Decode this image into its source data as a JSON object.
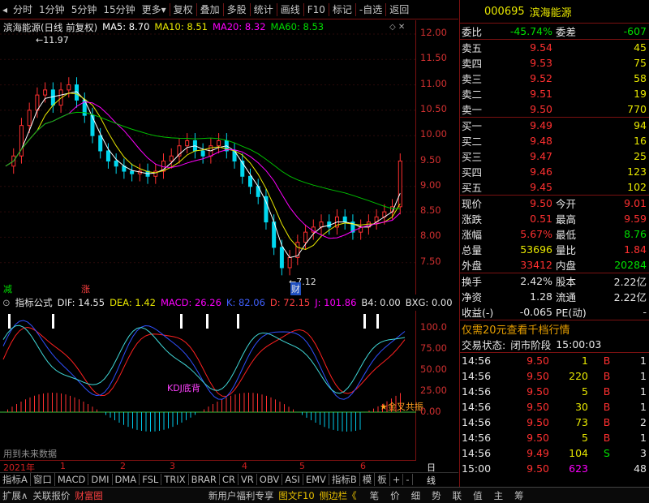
{
  "toolbar": {
    "periods": [
      "分时",
      "1分钟",
      "5分钟",
      "15分钟",
      "更多"
    ],
    "actions": [
      "复权",
      "叠加",
      "多股",
      "统计",
      "画线",
      "F10",
      "标记",
      "-自选",
      "返回"
    ]
  },
  "kchart": {
    "title": "滨海能源(日线 前复权)",
    "ma": [
      {
        "label": "MA5: 8.70",
        "color": "#ffffff"
      },
      {
        "label": "MA10: 8.51",
        "color": "#e8e800"
      },
      {
        "label": "MA20: 8.32",
        "color": "#ff00ff"
      },
      {
        "label": "MA60: 8.53",
        "color": "#00dd00"
      }
    ],
    "yticks": [
      "12.00",
      "11.50",
      "11.00",
      "10.50",
      "10.00",
      "9.50",
      "9.00",
      "8.50",
      "8.00",
      "7.50"
    ],
    "high_label": "11.97",
    "low_label": "7.12",
    "markers": {
      "minus": "减",
      "plus": "涨",
      "cai": "财"
    }
  },
  "indicator": {
    "name": "指标公式",
    "items": [
      {
        "label": "DIF: 14.55",
        "color": "#e6e6e6"
      },
      {
        "label": "DEA: 1.42",
        "color": "#e8e800"
      },
      {
        "label": "MACD: 26.26",
        "color": "#ff00ff"
      },
      {
        "label": "K: 82.06",
        "color": "#4060ff"
      },
      {
        "label": "D: 72.15",
        "color": "#ff4040"
      },
      {
        "label": "J: 101.86",
        "color": "#ff00ff"
      },
      {
        "label": "B4: 0.00",
        "color": "#e6e6e6"
      },
      {
        "label": "BXG: 0.00",
        "color": "#e6e6e6"
      }
    ],
    "yticks": [
      "100.0",
      "75.00",
      "50.00",
      "25.00",
      "0.00"
    ],
    "notes": {
      "kdj": "KDJ底背",
      "gold": "金叉共振",
      "future": "用到未来数据"
    }
  },
  "dates": {
    "year": "2021年",
    "months": [
      "1",
      "2",
      "3",
      "4",
      "5",
      "6"
    ],
    "right": "日线"
  },
  "tabs": [
    "指标A",
    "窗口",
    "MACD",
    "DMI",
    "DMA",
    "FSL",
    "TRIX",
    "BRAR",
    "CR",
    "VR",
    "OBV",
    "ASI",
    "EMV",
    "指标B",
    "模",
    "板",
    "+",
    "-"
  ],
  "statusbar": {
    "left": [
      "扩展∧",
      "关联报价",
      "财富圈"
    ],
    "middle": [
      "新用户福利专享",
      "图文F10",
      "侧边栏《"
    ],
    "right": [
      "笔",
      "价",
      "细",
      "势",
      "联",
      "值",
      "主",
      "筹"
    ]
  },
  "quote": {
    "code": "000695",
    "name": "滨海能源",
    "weibi_label": "委比",
    "weibi": "-45.74%",
    "weicha_label": "委差",
    "weicha": "-607",
    "asks": [
      {
        "label": "卖五",
        "price": "9.54",
        "vol": "45"
      },
      {
        "label": "卖四",
        "price": "9.53",
        "vol": "75"
      },
      {
        "label": "卖三",
        "price": "9.52",
        "vol": "58"
      },
      {
        "label": "卖二",
        "price": "9.51",
        "vol": "19"
      },
      {
        "label": "卖一",
        "price": "9.50",
        "vol": "770"
      }
    ],
    "bids": [
      {
        "label": "买一",
        "price": "9.49",
        "vol": "94"
      },
      {
        "label": "买二",
        "price": "9.48",
        "vol": "16"
      },
      {
        "label": "买三",
        "price": "9.47",
        "vol": "25"
      },
      {
        "label": "买四",
        "price": "9.46",
        "vol": "123"
      },
      {
        "label": "买五",
        "price": "9.45",
        "vol": "102"
      }
    ],
    "stats": [
      {
        "l1": "现价",
        "v1": "9.50",
        "c1": "red",
        "l2": "今开",
        "v2": "9.01",
        "c2": "red"
      },
      {
        "l1": "涨跌",
        "v1": "0.51",
        "c1": "red",
        "l2": "最高",
        "v2": "9.59",
        "c2": "red"
      },
      {
        "l1": "涨幅",
        "v1": "5.67%",
        "c1": "red",
        "l2": "最低",
        "v2": "8.76",
        "c2": "green"
      },
      {
        "l1": "总量",
        "v1": "53696",
        "c1": "yel",
        "l2": "量比",
        "v2": "1.84",
        "c2": "red"
      },
      {
        "l1": "外盘",
        "v1": "33412",
        "c1": "red",
        "l2": "内盘",
        "v2": "20284",
        "c2": "green"
      }
    ],
    "stats2": [
      {
        "l1": "换手",
        "v1": "2.42%",
        "l2": "股本",
        "v2": "2.22亿"
      },
      {
        "l1": "净资",
        "v1": "1.28",
        "l2": "流通",
        "v2": "2.22亿"
      },
      {
        "l1": "收益(-)",
        "v1": "-0.065",
        "l2": "PE(动)",
        "v2": "-"
      }
    ],
    "promo": "仅需20元查看千档行情",
    "status_label": "交易状态:",
    "status_value": "闭市阶段",
    "status_time": "15:00:03",
    "ticks": [
      {
        "t": "14:56",
        "p": "9.50",
        "v": "1",
        "s": "B",
        "n": "1"
      },
      {
        "t": "14:56",
        "p": "9.50",
        "v": "220",
        "s": "B",
        "n": "1"
      },
      {
        "t": "14:56",
        "p": "9.50",
        "v": "5",
        "s": "B",
        "n": "1"
      },
      {
        "t": "14:56",
        "p": "9.50",
        "v": "30",
        "s": "B",
        "n": "1"
      },
      {
        "t": "14:56",
        "p": "9.50",
        "v": "73",
        "s": "B",
        "n": "2"
      },
      {
        "t": "14:56",
        "p": "9.50",
        "v": "5",
        "s": "B",
        "n": "1"
      },
      {
        "t": "14:56",
        "p": "9.49",
        "v": "104",
        "s": "S",
        "n": "3"
      },
      {
        "t": "15:00",
        "p": "9.50",
        "v": "623",
        "s": "",
        "n": "48"
      }
    ]
  }
}
